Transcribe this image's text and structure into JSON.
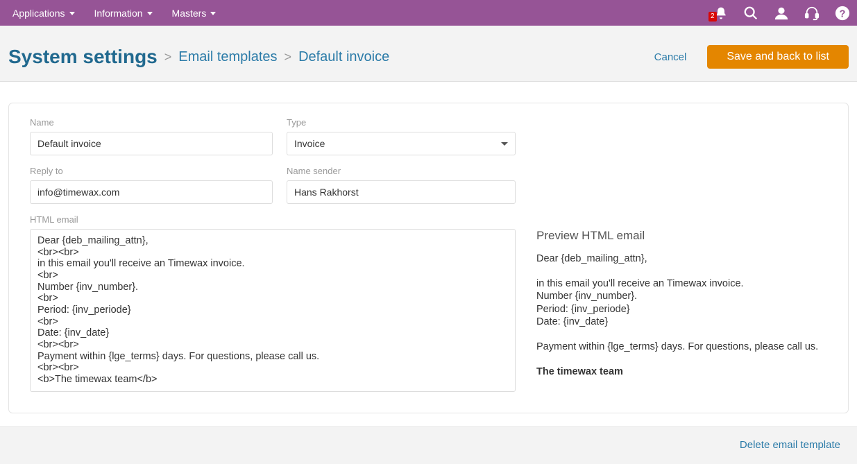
{
  "topnav": {
    "menus": [
      "Applications",
      "Information",
      "Masters"
    ],
    "notification_count": "2"
  },
  "breadcrumb": {
    "root": "System settings",
    "level1": "Email templates",
    "level2": "Default invoice"
  },
  "actions": {
    "cancel": "Cancel",
    "save": "Save and back to list"
  },
  "form": {
    "name_label": "Name",
    "name_value": "Default invoice",
    "type_label": "Type",
    "type_value": "Invoice",
    "reply_label": "Reply to",
    "reply_value": "info@timewax.com",
    "sender_label": "Name sender",
    "sender_value": "Hans Rakhorst",
    "html_label": "HTML email",
    "html_value": "Dear {deb_mailing_attn},\n<br><br>\nin this email you'll receive an Timewax invoice.\n<br>\nNumber {inv_number}.\n<br>\nPeriod: {inv_periode}\n<br>\nDate: {inv_date}\n<br><br>\nPayment within {lge_terms} days. For questions, please call us.\n<br><br>\n<b>The timewax team</b>"
  },
  "preview": {
    "title": "Preview HTML email",
    "body_html": "Dear {deb_mailing_attn},<br><br>in this email you'll receive an Timewax invoice.<br>Number {inv_number}.<br>Period: {inv_periode}<br>Date: {inv_date}<br><br>Payment within {lge_terms} days. For questions, please call us.<br><br><b>The timewax team</b>"
  },
  "footer": {
    "delete": "Delete email template"
  }
}
